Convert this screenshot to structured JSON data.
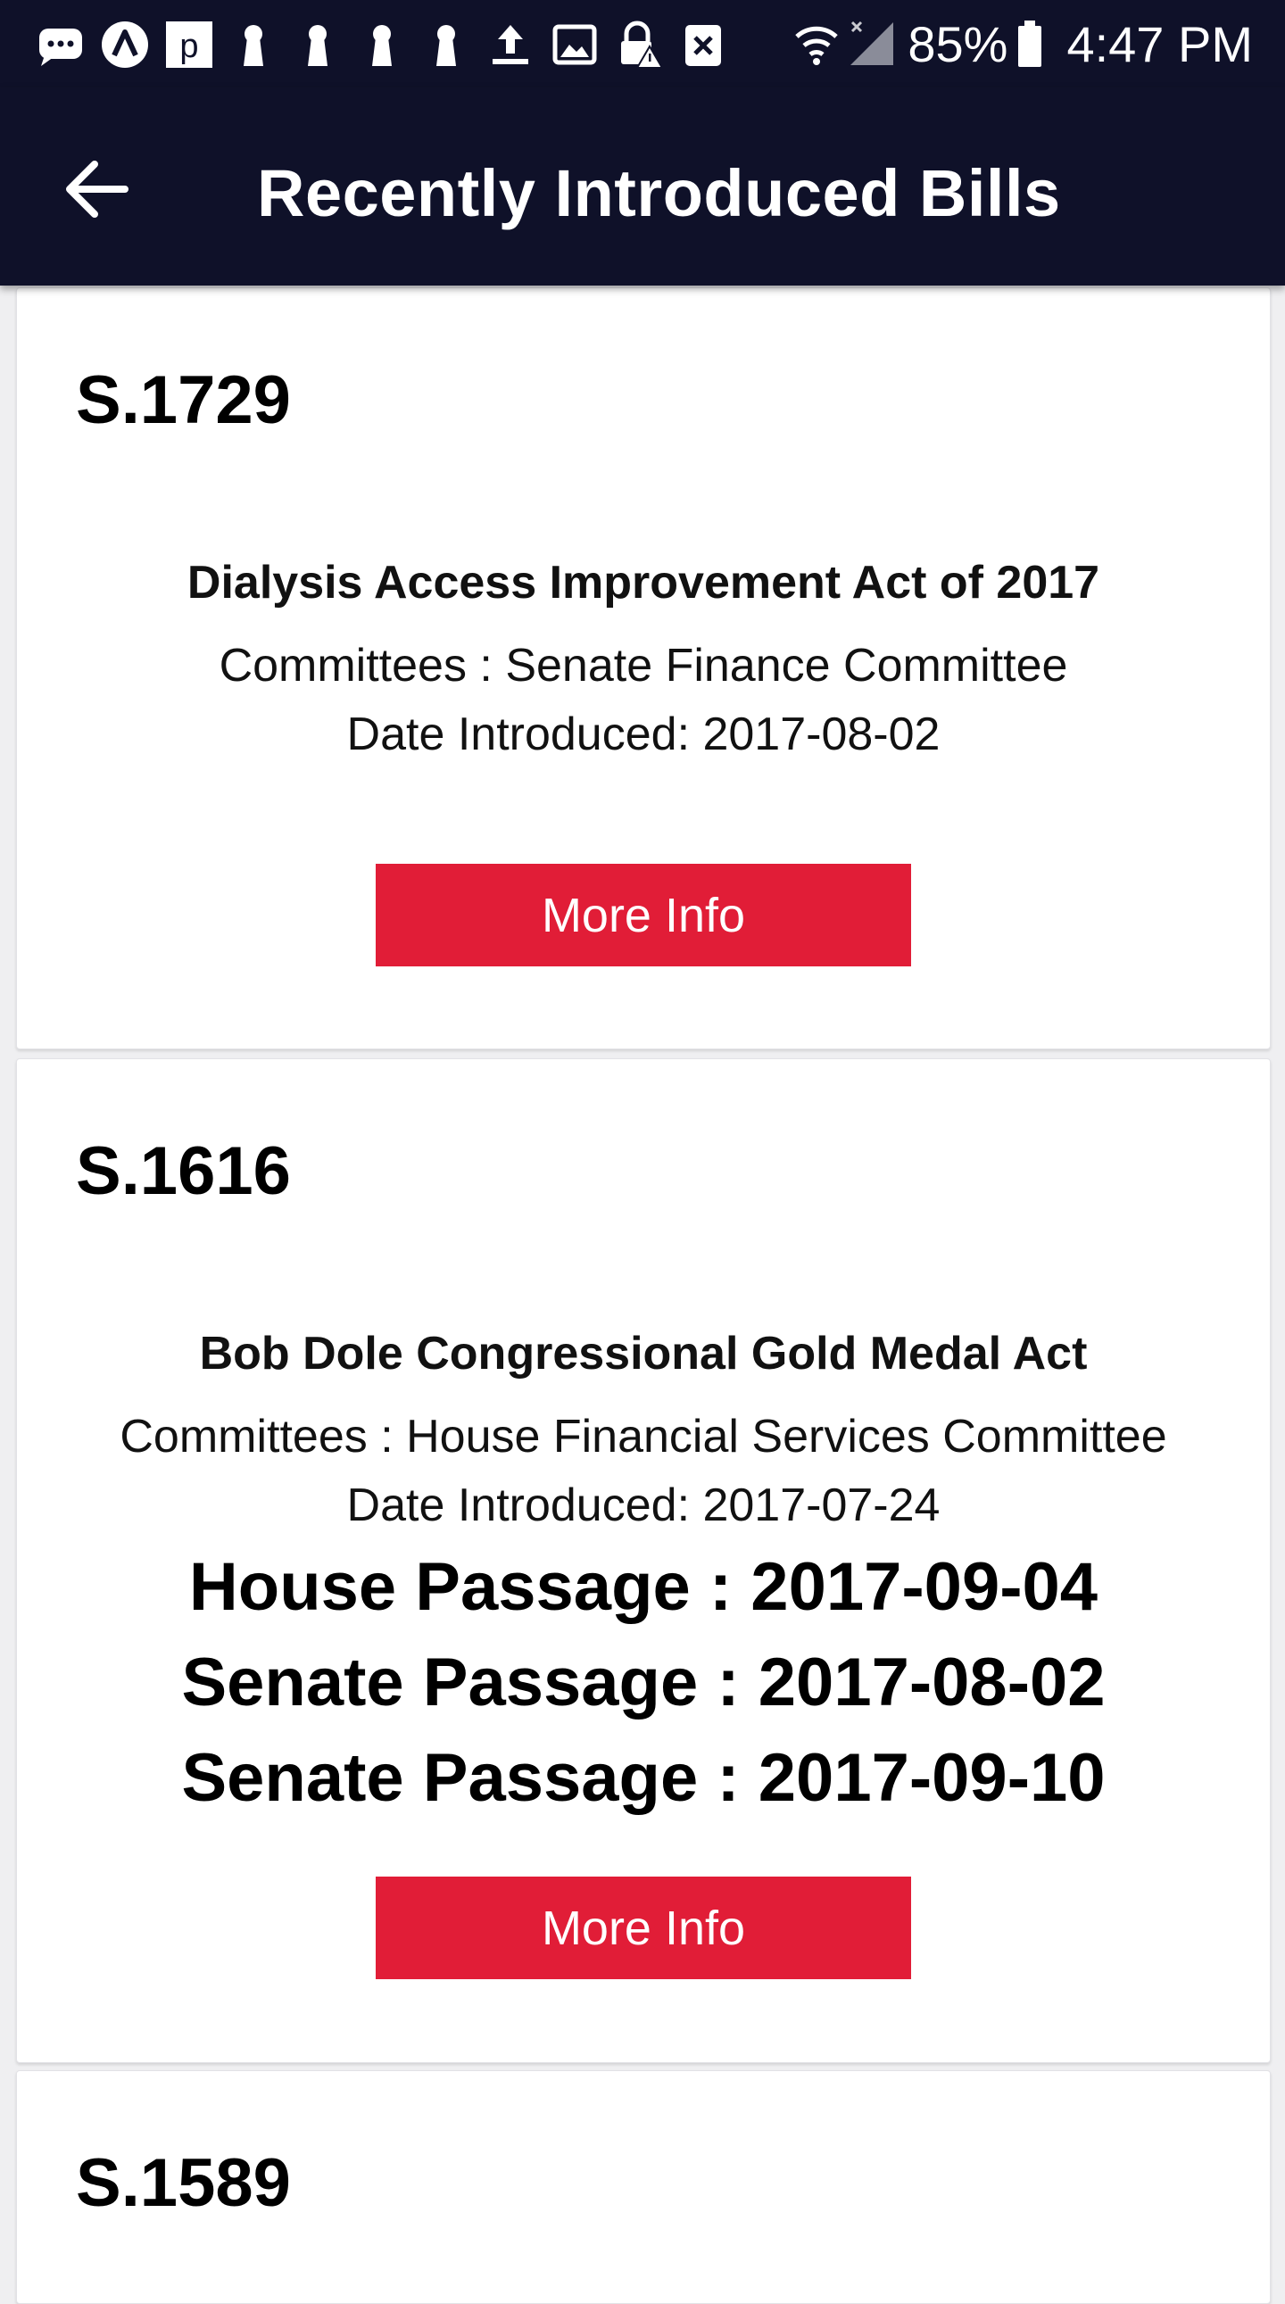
{
  "status_bar": {
    "icons": [
      "chat-icon",
      "a-app-icon",
      "p-app-icon",
      "keyhole-icon",
      "keyhole-icon",
      "keyhole-icon",
      "keyhole-icon",
      "upload-icon",
      "image-icon",
      "lock-warning-icon",
      "close-box-icon"
    ],
    "battery": "85%",
    "time": "4:47 PM"
  },
  "app_bar": {
    "title": "Recently Introduced Bills",
    "back_icon": "arrow-back-icon"
  },
  "bills": [
    {
      "id": "S.1729",
      "title": "Dialysis Access Improvement Act of 2017",
      "committees": "Committees : Senate Finance Committee",
      "date_introduced": "Date Introduced: 2017-08-02",
      "passages": [],
      "button": "More Info"
    },
    {
      "id": "S.1616",
      "title": "Bob Dole Congressional Gold Medal Act",
      "committees": "Committees : House Financial Services Committee",
      "date_introduced": "Date Introduced: 2017-07-24",
      "passages": [
        "House Passage : 2017-09-04",
        "Senate Passage : 2017-08-02",
        "Senate Passage : 2017-09-10"
      ],
      "button": "More Info"
    },
    {
      "id": "S.1589"
    }
  ],
  "colors": {
    "app_bar": "#0f1129",
    "button": "#e11d37",
    "background": "#efeff1"
  }
}
